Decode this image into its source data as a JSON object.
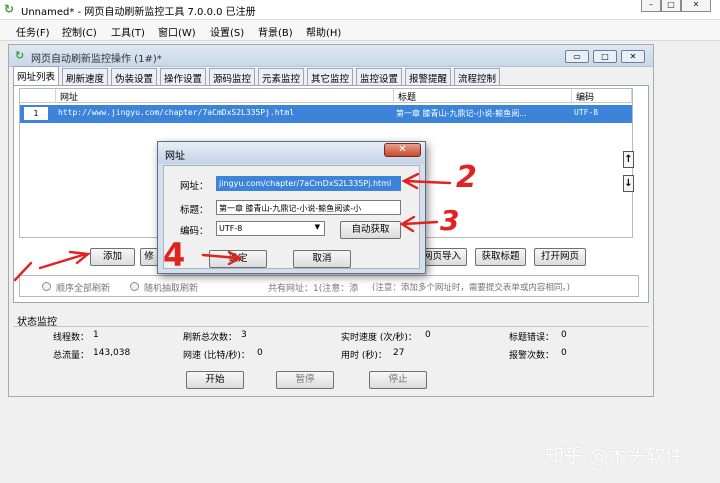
{
  "app": {
    "title": "Unnamed* - 网页自动刷新监控工具 7.0.0.0 已注册",
    "win_controls": [
      "–",
      "□",
      "✕"
    ]
  },
  "menu": [
    "任务(F)",
    "控制(C)",
    "工具(T)",
    "窗口(W)",
    "设置(S)",
    "背景(B)",
    "帮助(H)"
  ],
  "child_window": {
    "title": "网页自动刷新监控操作 (1#)*",
    "controls": [
      "▭",
      "□",
      "✕"
    ],
    "tabs": [
      "网址列表",
      "刷新速度",
      "伪装设置",
      "操作设置",
      "源码监控",
      "元素监控",
      "其它监控",
      "监控设置",
      "报警提醒",
      "流程控制"
    ]
  },
  "table": {
    "columns": [
      "",
      "网址",
      "标题",
      "编码"
    ],
    "rows": [
      {
        "index": "1",
        "url": "http://www.jingyu.com/chapter/7aCmDxS2L335Pj.html",
        "title": "第一章 膝青山-九鼎记-小说-鲸鱼阅...",
        "encoding": "UTF-8"
      }
    ]
  },
  "buttons": {
    "add": "添加",
    "hidden_left": "修",
    "import_url": "网页导入",
    "fetch_title": "获取标题",
    "open_page": "打开网页"
  },
  "refresh_mode": {
    "sequential": "顺序全部刷新",
    "random": "随机抽取刷新",
    "summary": "共有网址：1(注意：添",
    "note": "(注意：添加多个网址时，需要提交表单或内容相同。)"
  },
  "status": {
    "section": "状态监控",
    "thread_label": "线程数：",
    "thread_value": "1",
    "refresh_label": "刷新总次数：",
    "refresh_value": "3",
    "speed_label": "实时速度 (次/秒)：",
    "speed_value": "0",
    "title_err_label": "标题错误：",
    "title_err_value": "0",
    "traffic_label": "总流量：",
    "traffic_value": "143,038",
    "net_speed_label": "网速 (比特/秒)：",
    "net_speed_value": "0",
    "time_label": "用时 (秒)：",
    "time_value": "27",
    "alarm_label": "报警次数：",
    "alarm_value": "0"
  },
  "controls": {
    "start": "开始",
    "pause": "暂停",
    "stop": "停止"
  },
  "dialog": {
    "title": "网址",
    "close": "✕",
    "url_label": "网址：",
    "url_value": "jingyu.com/chapter/7aCmDxS2L335Pj.html",
    "title_label": "标题：",
    "title_value": "第一章 膝青山-九鼎记-小说-鲸鱼阅读-小",
    "encoding_label": "编码：",
    "encoding_value": "UTF-8",
    "auto_fetch": "自动获取",
    "ok": "确定",
    "cancel": "取消"
  },
  "annotations": {
    "n1": "1",
    "n2": "2",
    "n3": "3",
    "n4": "4"
  },
  "watermark": "知乎 @木头软件"
}
